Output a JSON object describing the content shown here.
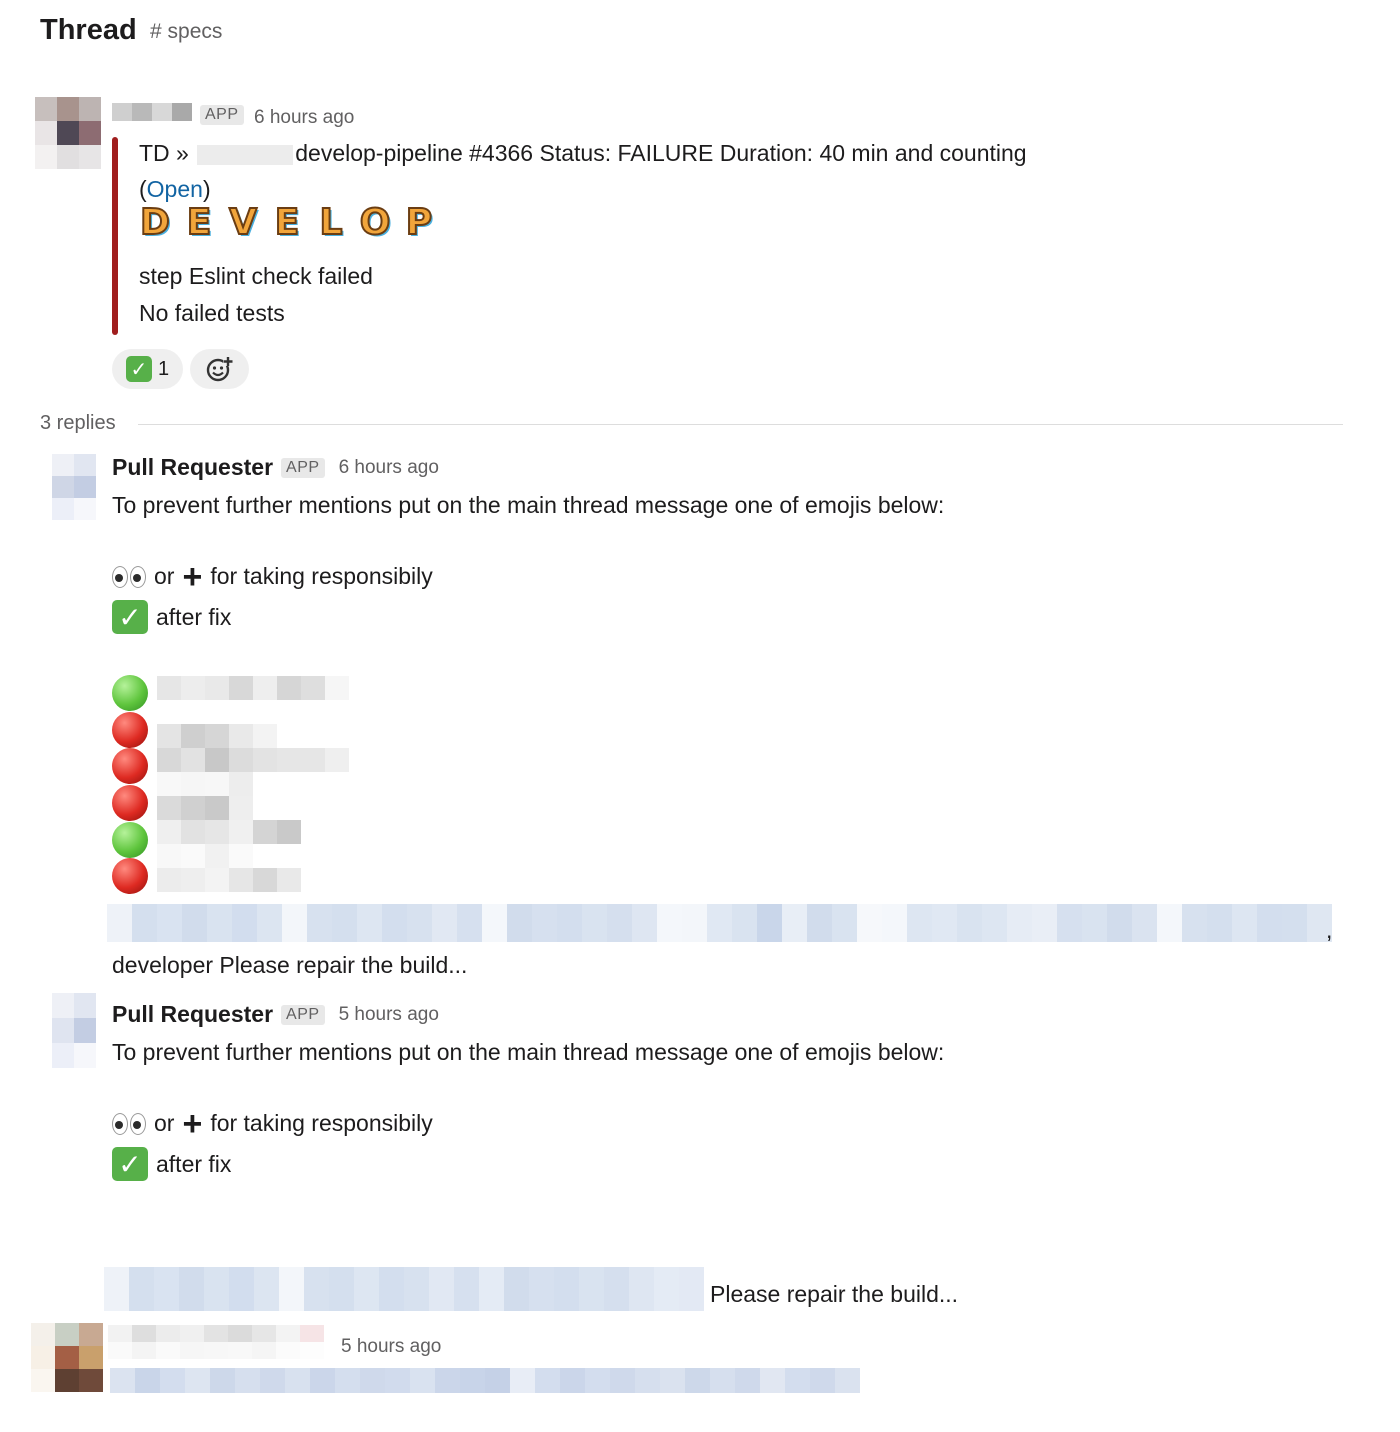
{
  "header": {
    "title": "Thread",
    "channel": "# specs"
  },
  "root_message": {
    "badge": "APP",
    "timestamp": "6 hours ago",
    "line1_prefix": "TD »",
    "line1_rest": "develop-pipeline #4366 Status: FAILURE Duration: 40 min and counting",
    "open_paren_left": "(",
    "open_link": "Open",
    "open_paren_right": ")",
    "develop_letters": [
      "D",
      "E",
      "V",
      "E",
      "L",
      "O",
      "P"
    ],
    "step_line": "step Eslint check failed",
    "tests_line": "No failed tests",
    "accent_color": "#a01e1e",
    "reactions": [
      {
        "icon": "white-check-mark-icon",
        "count": "1"
      },
      {
        "icon": "add-reaction-icon",
        "count": ""
      }
    ]
  },
  "replies": {
    "label": "3 replies",
    "items": [
      {
        "sender": "Pull Requester",
        "badge": "APP",
        "timestamp": "6 hours ago",
        "intro": "To prevent further mentions put on the main thread message one of emojis below:",
        "or_text": "or",
        "taking_text": "for taking responsibily",
        "after_fix": "after fix",
        "status_dots": [
          "green",
          "red",
          "red",
          "red",
          "green",
          "red"
        ],
        "trailing_comma": ",",
        "closing": "developer Please repair the build..."
      },
      {
        "sender": "Pull Requester",
        "badge": "APP",
        "timestamp": "5 hours ago",
        "intro": "To prevent further mentions put on the main thread message one of emojis below:",
        "or_text": "or",
        "taking_text": "for taking responsibily",
        "after_fix": "after fix",
        "closing": "Please repair the build..."
      },
      {
        "timestamp": "5 hours ago"
      }
    ]
  }
}
